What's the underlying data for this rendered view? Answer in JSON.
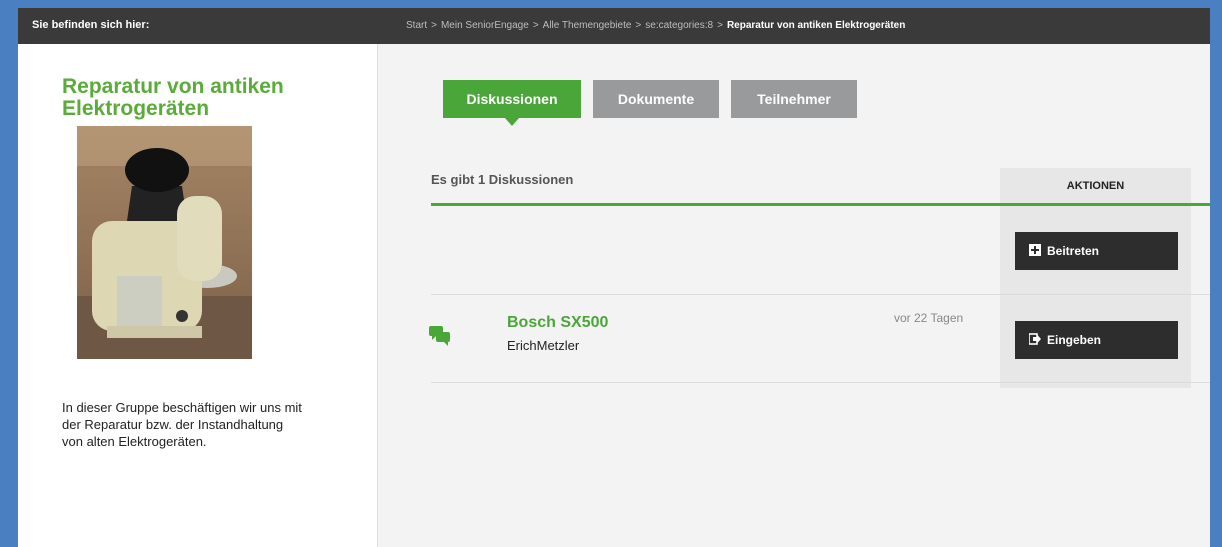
{
  "header": {
    "you_are_here": "Sie befinden sich hier:",
    "breadcrumb": {
      "items": [
        "Start",
        "Mein SeniorEngage",
        "Alle Themengebiete",
        "se:categories:8"
      ],
      "current": "Reparatur von antiken Elektrogeräten",
      "separator": ">"
    }
  },
  "sidebar": {
    "group_title": "Reparatur von antiken Elektrogeräten",
    "description": "In dieser Gruppe beschäftigen wir uns mit der Reparatur bzw. der Instandhaltung von alten Elektrogeräten."
  },
  "tabs": [
    {
      "label": "Diskussionen",
      "active": true
    },
    {
      "label": "Dokumente",
      "active": false
    },
    {
      "label": "Teilnehmer",
      "active": false
    }
  ],
  "discussions": {
    "count_text": "Es gibt 1 Diskussionen",
    "actions_header": "AKTIONEN",
    "join_button": "Beitreten",
    "items": [
      {
        "title": "Bosch SX500",
        "author": "ErichMetzler",
        "age": "vor 22 Tagen",
        "action": "Eingeben",
        "icon": "chat-bubbles-icon"
      }
    ]
  },
  "colors": {
    "accent_green": "#4ba63a",
    "title_green": "#5aab3a",
    "topbar": "#3a3a3a",
    "inactive_tab": "#999a9c",
    "button_dark": "#2d2d2d",
    "outer_frame": "#4a7fc1"
  }
}
